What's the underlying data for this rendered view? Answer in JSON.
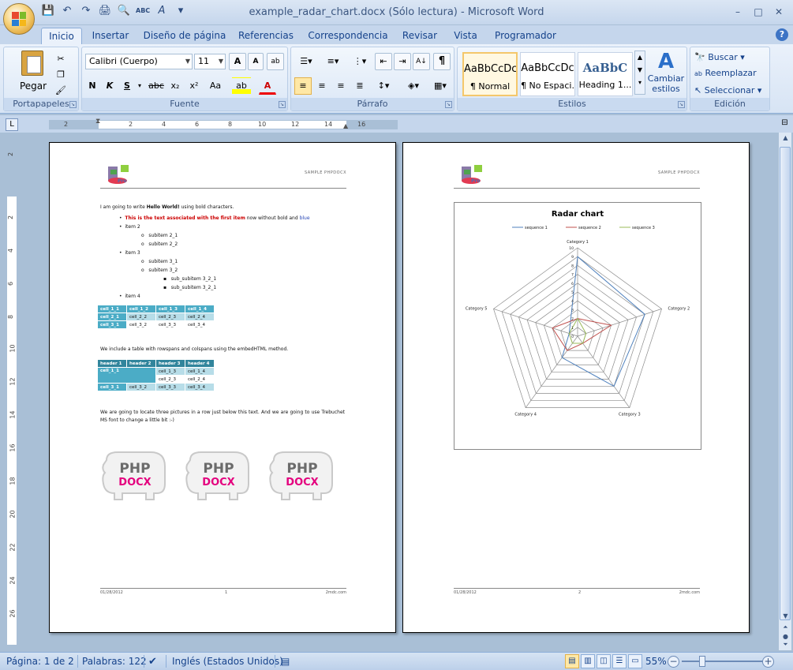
{
  "window": {
    "title": "example_radar_chart.docx (Sólo lectura) - Microsoft Word",
    "minimize": "–",
    "maximize": "□",
    "close": "✕"
  },
  "qat": {
    "save": "💾",
    "undo": "↶",
    "redo": "↷",
    "print": "🖨",
    "preview": "🔍",
    "spell": "ABC",
    "format": "A",
    "more": "▾"
  },
  "tabs": [
    {
      "label": "Inicio"
    },
    {
      "label": "Insertar"
    },
    {
      "label": "Diseño de página"
    },
    {
      "label": "Referencias"
    },
    {
      "label": "Correspondencia"
    },
    {
      "label": "Revisar"
    },
    {
      "label": "Vista"
    },
    {
      "label": "Programador"
    }
  ],
  "ribbon": {
    "clipboard": {
      "label": "Portapapeles",
      "paste": "Pegar"
    },
    "font": {
      "label": "Fuente",
      "family": "Calibri (Cuerpo)",
      "size": "11",
      "bold": "N",
      "italic": "K",
      "underline": "S",
      "strike": "abc",
      "sub": "x₂",
      "sup": "x²",
      "case": "Aa",
      "grow": "A",
      "shrink": "A",
      "highlight": "ab",
      "color": "A"
    },
    "paragraph": {
      "label": "Párrafo",
      "pilcrow": "¶"
    },
    "styles": {
      "label": "Estilos",
      "items": [
        {
          "sample": "AaBbCcDc",
          "name": "¶ Normal"
        },
        {
          "sample": "AaBbCcDc",
          "name": "¶ No Espaci..."
        },
        {
          "sample": "AaBbC",
          "name": "Heading 1..."
        }
      ],
      "change": "Cambiar estilos"
    },
    "editing": {
      "label": "Edición",
      "find": "Buscar",
      "replace": "Reemplazar",
      "select": "Seleccionar"
    }
  },
  "ruler": {
    "h_numbers": [
      "2",
      "2",
      "4",
      "6",
      "8",
      "10",
      "12",
      "14",
      "16"
    ],
    "v_numbers": [
      "2",
      "2",
      "4",
      "6",
      "8",
      "10",
      "12",
      "14",
      "16",
      "18",
      "20",
      "22",
      "24",
      "26"
    ]
  },
  "page1": {
    "header_right": "SAMPLE PHPDOCX",
    "intro": {
      "pre": "I am going to write ",
      "bold": "Hello World!",
      "post": " using bold characters."
    },
    "bullet1": {
      "red": "This is the text associated with the first item",
      "mid": " now without bold ",
      "and": "and",
      "blue": " blue"
    },
    "list": {
      "item2": "item 2",
      "sub21": "subitem 2_1",
      "sub22": "subitem 2_2",
      "item3": "item 3",
      "sub31": "subitem 3_1",
      "sub32": "subitem 3_2",
      "subsub321": "sub_subitem 3_2_1",
      "subsub322": "sub_subitem 3_2_1",
      "item4": "item 4"
    },
    "table1": [
      [
        "cell_1_1",
        "cell_1_2",
        "cell_1_3",
        "cell_1_4"
      ],
      [
        "cell_2_1",
        "cell_2_2",
        "cell_2_3",
        "cell_2_4"
      ],
      [
        "cell_3_1",
        "cell_3_2",
        "cell_3_3",
        "cell_3_4"
      ]
    ],
    "table2_intro": "We include a table with rowspans and colspans using the embedHTML method.",
    "table2": {
      "headers": [
        "header 1",
        "header 2",
        "header 3",
        "header 4"
      ],
      "c11": "cell_1_1",
      "c13": "cell_1_3",
      "c14": "cell_1_4",
      "c23": "cell_2_3",
      "c24": "cell_2_4",
      "c31": "cell_3_1",
      "c32": "cell_3_2",
      "c33": "cell_3_3",
      "c34": "cell_3_4"
    },
    "pics_text": "We are going to locate three pictures in a row just below this text. And we are going to use Trebuchet MS font to change a little bit :-)",
    "logo_line1": "PHP",
    "logo_line2": "DOCX",
    "footer_left": "01/28/2012",
    "footer_center": "1",
    "footer_right": "2mdc.com"
  },
  "page2": {
    "header_right": "SAMPLE PHPDOCX",
    "footer_left": "01/28/2012",
    "footer_center": "2",
    "footer_right": "2mdc.com"
  },
  "chart_data": {
    "type": "radar",
    "title": "Radar chart",
    "categories": [
      "Category 1",
      "Category 2",
      "Category 3",
      "Category 4",
      "Category 5"
    ],
    "series": [
      {
        "name": "sequence 1",
        "values": [
          9,
          8,
          7,
          3,
          1
        ],
        "color": "#4f81bd"
      },
      {
        "name": "sequence 2",
        "values": [
          2,
          4,
          1,
          2,
          3
        ],
        "color": "#c0504d"
      },
      {
        "name": "sequence 3",
        "values": [
          2,
          1,
          1,
          1,
          1
        ],
        "color": "#9bbb59"
      }
    ],
    "rlim": [
      0,
      10
    ],
    "ticks": [
      "0",
      "1",
      "2",
      "3",
      "4",
      "5",
      "6",
      "7",
      "8",
      "9",
      "10"
    ],
    "legend": "top"
  },
  "status": {
    "page": "Página: 1 de 2",
    "words": "Palabras: 122",
    "language": "Inglés (Estados Unidos)",
    "zoom": "55%",
    "zoom_out": "−",
    "zoom_in": "+"
  },
  "colors": {
    "accent": "#15428b",
    "table_dark": "#4bacc6",
    "table_light": "#b7dde8",
    "phpdocx_pink": "#e4007e"
  }
}
